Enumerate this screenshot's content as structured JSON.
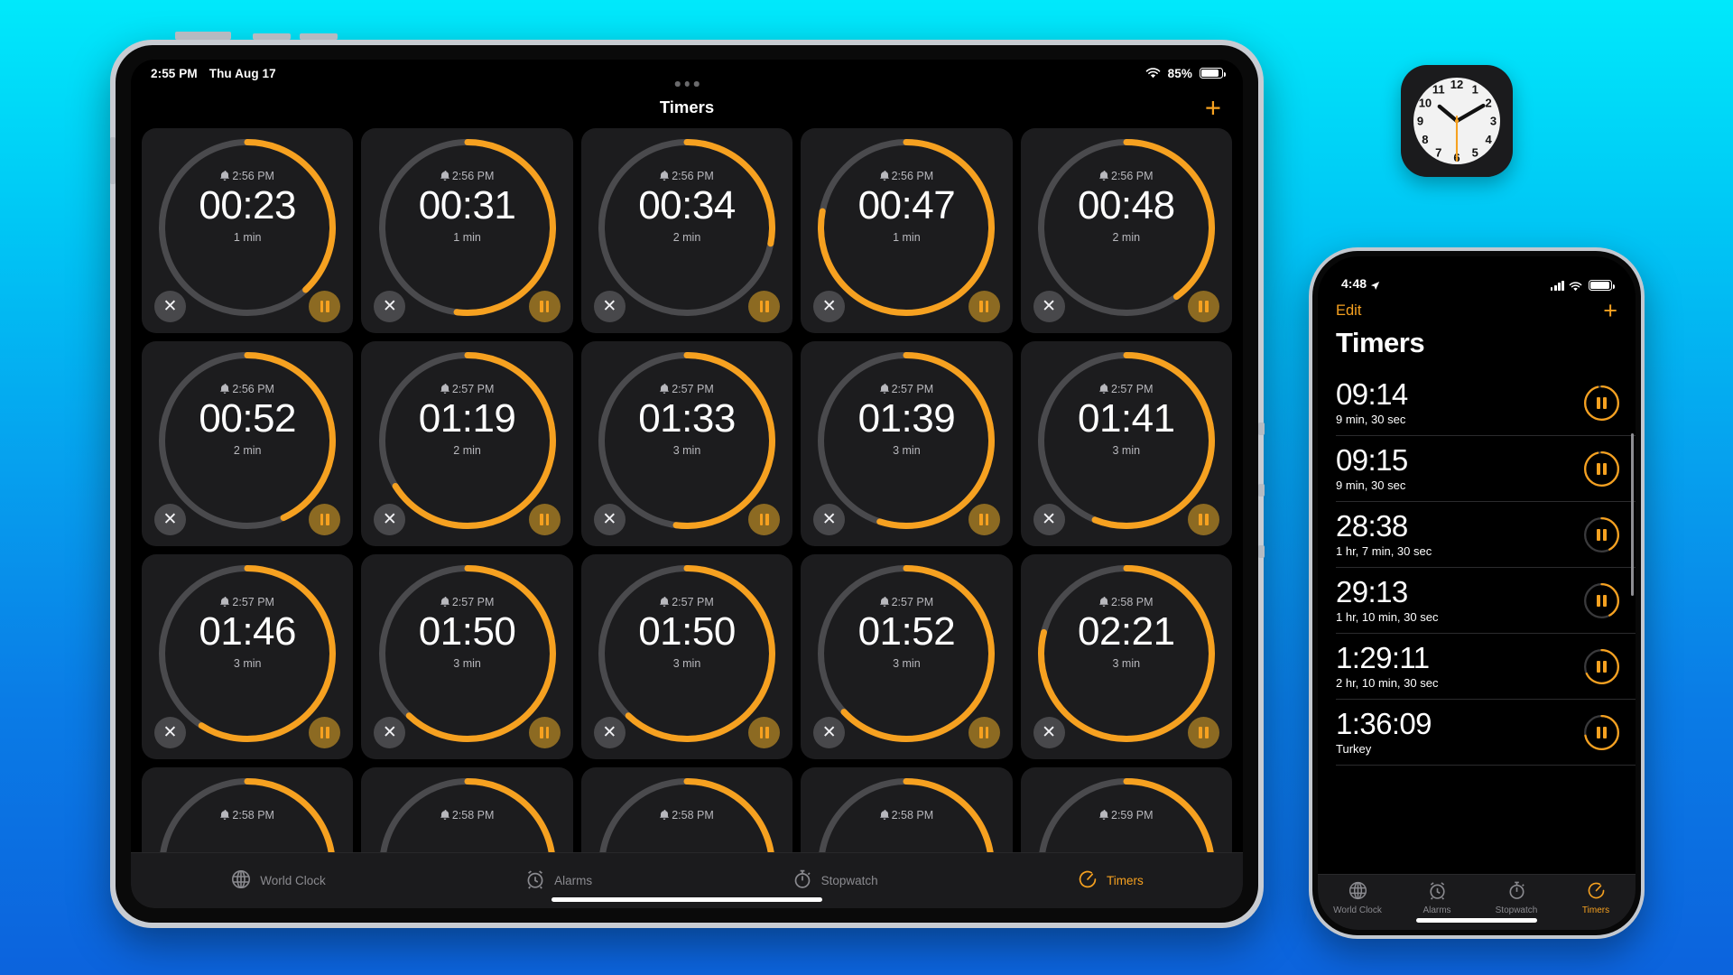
{
  "background": {
    "top_color": "#00e9fb",
    "bottom_color": "#0c63dd"
  },
  "accent": {
    "orange": "#f6a120",
    "pause_fill": "#8c6a22",
    "ring_track": "#4a4a4d"
  },
  "ipad": {
    "status": {
      "time": "2:55 PM",
      "date": "Thu Aug 17",
      "battery_pct": "85%",
      "wifi_icon": "wifi-icon",
      "battery_icon": "battery-icon"
    },
    "nav": {
      "title": "Timers",
      "add_label": "+",
      "multitask_icon": "multitask-dots-icon"
    },
    "timers": [
      {
        "alarm": "2:56 PM",
        "time": "00:23",
        "duration": "1 min",
        "progress": 0.38
      },
      {
        "alarm": "2:56 PM",
        "time": "00:31",
        "duration": "1 min",
        "progress": 0.52
      },
      {
        "alarm": "2:56 PM",
        "time": "00:34",
        "duration": "2 min",
        "progress": 0.28
      },
      {
        "alarm": "2:56 PM",
        "time": "00:47",
        "duration": "1 min",
        "progress": 0.78
      },
      {
        "alarm": "2:56 PM",
        "time": "00:48",
        "duration": "2 min",
        "progress": 0.4
      },
      {
        "alarm": "2:56 PM",
        "time": "00:52",
        "duration": "2 min",
        "progress": 0.43
      },
      {
        "alarm": "2:57 PM",
        "time": "01:19",
        "duration": "2 min",
        "progress": 0.66
      },
      {
        "alarm": "2:57 PM",
        "time": "01:33",
        "duration": "3 min",
        "progress": 0.52
      },
      {
        "alarm": "2:57 PM",
        "time": "01:39",
        "duration": "3 min",
        "progress": 0.55
      },
      {
        "alarm": "2:57 PM",
        "time": "01:41",
        "duration": "3 min",
        "progress": 0.56
      },
      {
        "alarm": "2:57 PM",
        "time": "01:46",
        "duration": "3 min",
        "progress": 0.59
      },
      {
        "alarm": "2:57 PM",
        "time": "01:50",
        "duration": "3 min",
        "progress": 0.62
      },
      {
        "alarm": "2:57 PM",
        "time": "01:50",
        "duration": "3 min",
        "progress": 0.62
      },
      {
        "alarm": "2:57 PM",
        "time": "01:52",
        "duration": "3 min",
        "progress": 0.63
      },
      {
        "alarm": "2:58 PM",
        "time": "02:21",
        "duration": "3 min",
        "progress": 0.79
      },
      {
        "alarm": "2:58 PM",
        "time": "",
        "duration": "",
        "progress": 0.3
      },
      {
        "alarm": "2:58 PM",
        "time": "",
        "duration": "",
        "progress": 0.3
      },
      {
        "alarm": "2:58 PM",
        "time": "",
        "duration": "",
        "progress": 0.3
      },
      {
        "alarm": "2:58 PM",
        "time": "",
        "duration": "",
        "progress": 0.3
      },
      {
        "alarm": "2:59 PM",
        "time": "",
        "duration": "",
        "progress": 0.3
      }
    ],
    "card_controls": {
      "cancel_label": "✕",
      "pause_icon": "pause-icon",
      "alarm_icon": "bell-icon"
    },
    "tabs": [
      {
        "label": "World Clock",
        "icon": "globe-icon",
        "active": false
      },
      {
        "label": "Alarms",
        "icon": "alarm-clock-icon",
        "active": false
      },
      {
        "label": "Stopwatch",
        "icon": "stopwatch-icon",
        "active": false
      },
      {
        "label": "Timers",
        "icon": "timer-icon",
        "active": true
      }
    ]
  },
  "iphone": {
    "status": {
      "time": "4:48",
      "location_icon": "location-arrow-icon",
      "signal_icon": "cellular-signal-icon",
      "wifi_icon": "wifi-icon",
      "battery_icon": "battery-icon"
    },
    "topbar": {
      "edit_label": "Edit",
      "add_label": "+"
    },
    "title": "Timers",
    "timers": [
      {
        "time": "09:14",
        "label": "9 min, 30 sec",
        "progress": 0.96
      },
      {
        "time": "09:15",
        "label": "9 min, 30 sec",
        "progress": 0.96
      },
      {
        "time": "28:38",
        "label": "1 hr, 7 min, 30 sec",
        "progress": 0.42
      },
      {
        "time": "29:13",
        "label": "1 hr, 10 min, 30 sec",
        "progress": 0.42
      },
      {
        "time": "1:29:11",
        "label": "2 hr, 10 min, 30 sec",
        "progress": 0.68
      },
      {
        "time": "1:36:09",
        "label": "Turkey",
        "progress": 0.72
      }
    ],
    "tabs": [
      {
        "label": "World Clock",
        "icon": "globe-icon",
        "active": false
      },
      {
        "label": "Alarms",
        "icon": "alarm-clock-icon",
        "active": false
      },
      {
        "label": "Stopwatch",
        "icon": "stopwatch-icon",
        "active": false
      },
      {
        "label": "Timers",
        "icon": "timer-icon",
        "active": true
      }
    ]
  },
  "clock_icon": {
    "name": "clock-app-icon",
    "numerals": [
      "12",
      "1",
      "2",
      "3",
      "4",
      "5",
      "6",
      "7",
      "8",
      "9",
      "10",
      "11"
    ],
    "hour_hand": "10",
    "minute_hand": "2",
    "second_hand": "6",
    "second_hand_color": "#f6a120"
  }
}
